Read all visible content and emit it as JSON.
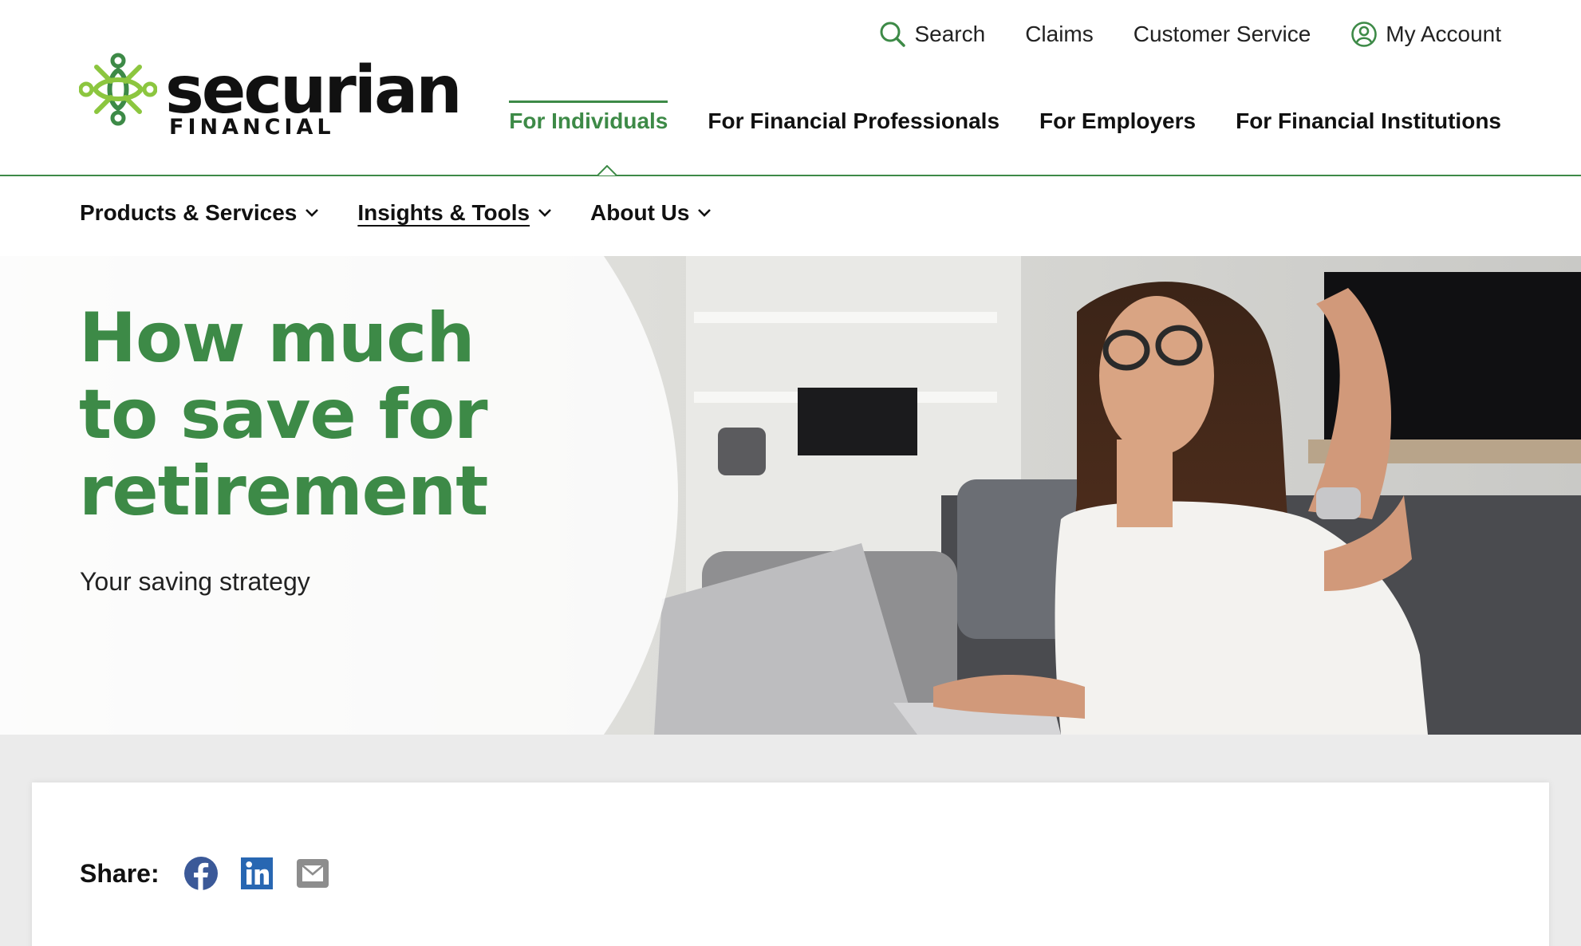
{
  "brand": {
    "name": "securian",
    "tagline": "FINANCIAL",
    "green": "#3d8a47",
    "light_green": "#8cc63f"
  },
  "utility_nav": {
    "search": "Search",
    "claims": "Claims",
    "customer_service": "Customer Service",
    "my_account": "My Account"
  },
  "audience_nav": {
    "items": [
      {
        "label": "For Individuals",
        "active": true
      },
      {
        "label": "For Financial Professionals",
        "active": false
      },
      {
        "label": "For Employers",
        "active": false
      },
      {
        "label": "For Financial Institutions",
        "active": false
      }
    ]
  },
  "sub_nav": {
    "items": [
      {
        "label": "Products & Services"
      },
      {
        "label": "Insights & Tools"
      },
      {
        "label": "About Us"
      }
    ]
  },
  "hero": {
    "title": "How much to save for retirement",
    "subtitle": "Your saving strategy"
  },
  "share": {
    "label": "Share:",
    "icons": [
      "facebook-icon",
      "linkedin-icon",
      "email-icon"
    ]
  }
}
